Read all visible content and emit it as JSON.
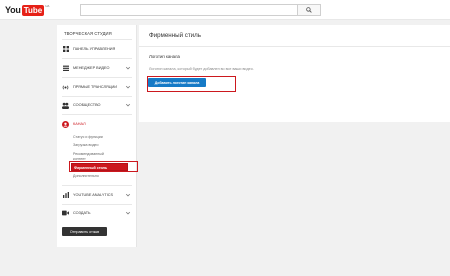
{
  "masthead": {
    "logo_you": "You",
    "logo_tube": "Tube",
    "logo_sup": "UA",
    "search_value": "",
    "search_icon": "search-icon"
  },
  "sidebar": {
    "studio_title": "ТВОРЧЕСКАЯ СТУДИЯ",
    "items": [
      {
        "label": "ПАНЕЛЬ УПРАВЛЕНИЯ",
        "icon": "dashboard-icon"
      },
      {
        "label": "МЕНЕДЖЕР ВИДЕО",
        "icon": "video-manager-icon"
      },
      {
        "label": "ПРЯМЫЕ ТРАНСЛЯЦИИ",
        "icon": "live-stream-icon"
      },
      {
        "label": "СООБЩЕСТВО",
        "icon": "community-icon"
      },
      {
        "label": "КАНАЛ",
        "icon": "channel-icon"
      },
      {
        "label": "YOUTUBE ANALYTICS",
        "icon": "analytics-icon"
      },
      {
        "label": "СОЗДАТЬ",
        "icon": "create-icon"
      }
    ],
    "channel_sub": [
      "Статус и функции",
      "Загрузка видео",
      "Рекомендованный",
      "контент",
      "Фирменный стиль",
      "Дополнительно"
    ],
    "feedback_label": "Отправить отзыв",
    "active_color": "#cc181e"
  },
  "main": {
    "title": "Фирменный стиль",
    "section_title": "Логотип канала",
    "section_desc": "Логотип канала, который будет добавлен во все ваши видео.",
    "add_logo_label": "Добавить логотип канала",
    "button_color": "#167ac6"
  }
}
